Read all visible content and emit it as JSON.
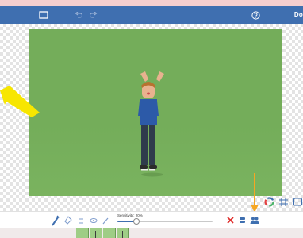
{
  "toolbar": {
    "done_label": "Do",
    "icons": [
      "crop-frame-icon",
      "undo-icon",
      "redo-icon",
      "help-icon"
    ]
  },
  "tools": {
    "icons": [
      "magic-wand-icon",
      "eraser-icon",
      "brush-icon",
      "eye-icon",
      "pen-icon"
    ],
    "sensitivity_label": "Sensitivity: 20%",
    "sensitivity_value": 0.2
  },
  "actions": {
    "clear_label": "Clear",
    "insert_label": "Insert",
    "people_label": "People"
  },
  "side_icons": [
    "color-wheel-icon",
    "grid-icon",
    "layers-icon"
  ],
  "colors": {
    "toolbar": "#3f6fb0",
    "accent_arrow": "#f5a623",
    "highlight_arrow": "#f7e600",
    "green_screen": "#74ad5a",
    "clear_red": "#e0302e"
  }
}
